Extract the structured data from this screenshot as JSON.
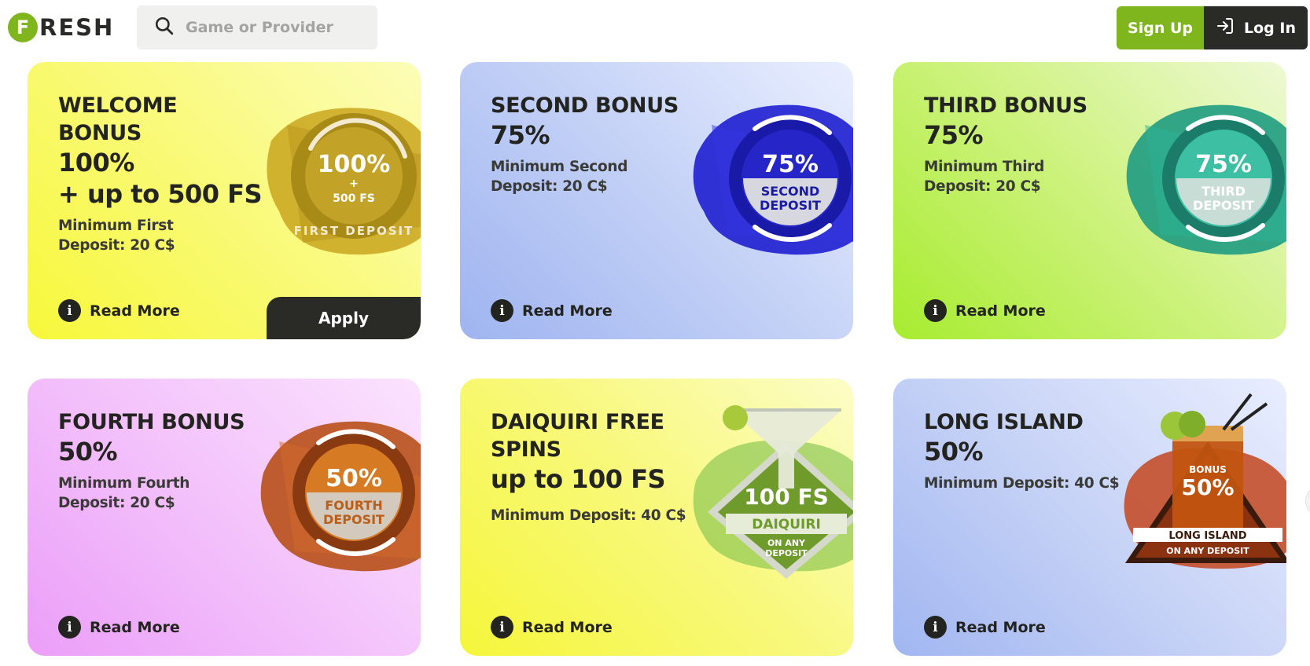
{
  "header": {
    "logo_letter": "F",
    "logo_rest": "RESH",
    "search_placeholder": "Game or Provider",
    "signup_label": "Sign Up",
    "login_label": "Log In"
  },
  "cards": [
    {
      "title": "WELCOME BONUS",
      "percent_line1": "100%",
      "percent_line2": "+ up to 500 FS",
      "desc_line1": "Minimum First",
      "desc_line2": "Deposit: 20 C$",
      "read_more": "Read More",
      "apply_label": "Apply",
      "badge": {
        "big": "100%",
        "plus": "+",
        "small": "500 FS",
        "ring_text": "FIRST DEPOSIT",
        "color": "#c9a51f",
        "dark": "#8f7410"
      }
    },
    {
      "title": "SECOND BONUS",
      "percent_line1": "75%",
      "desc_line1": "Minimum Second",
      "desc_line2": "Deposit: 20 C$",
      "read_more": "Read More",
      "badge": {
        "big": "75%",
        "line1": "SECOND",
        "line2": "DEPOSIT",
        "color": "#2a2ad8",
        "dark": "#1a1a9a"
      }
    },
    {
      "title": "THIRD BONUS",
      "percent_line1": "75%",
      "desc_line1": "Minimum Third",
      "desc_line2": "Deposit: 20 C$",
      "read_more": "Read More",
      "badge": {
        "big": "75%",
        "line1": "THIRD",
        "line2": "DEPOSIT",
        "color": "#2aa88e",
        "dark": "#1c7a66"
      }
    },
    {
      "title": "FOURTH BONUS",
      "percent_line1": "50%",
      "desc_line1": "Minimum Fourth",
      "desc_line2": "Deposit: 20 C$",
      "read_more": "Read More",
      "badge": {
        "big": "50%",
        "line1": "FOURTH",
        "line2": "DEPOSIT",
        "color": "#c05a1c",
        "dark": "#8a3a10"
      }
    },
    {
      "title": "DAIQUIRI FREE SPINS",
      "percent_line1": "up to 100 FS",
      "desc_line1": "Minimum Deposit: 40 C$",
      "read_more": "Read More",
      "badge": {
        "big": "100 FS",
        "line1": "DAIQUIRI",
        "line2": "ON ANY",
        "line3": "DEPOSIT",
        "color": "#6f9a2c",
        "dark": "#4c6d1c"
      }
    },
    {
      "title": "LONG ISLAND",
      "percent_line1": "50%",
      "desc_line1": "Minimum Deposit: 40 C$",
      "read_more": "Read More",
      "badge": {
        "small": "BONUS",
        "big": "50%",
        "line1": "LONG ISLAND",
        "line2": "ON ANY DEPOSIT",
        "color": "#c4471e",
        "dark": "#7a2a10"
      }
    }
  ]
}
